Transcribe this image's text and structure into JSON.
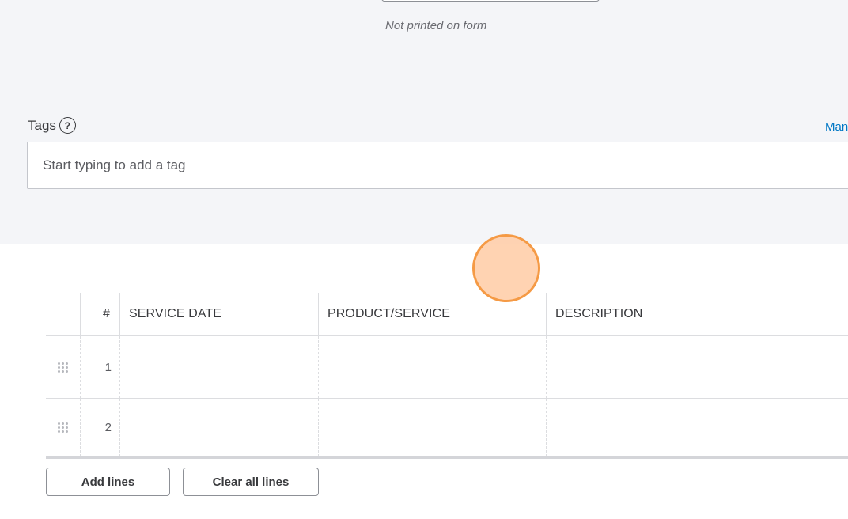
{
  "memo": {
    "note": "Not printed on form"
  },
  "tags": {
    "label": "Tags",
    "help_symbol": "?",
    "manage_link": "Manage tags",
    "placeholder": "Start typing to add a tag"
  },
  "table": {
    "headers": {
      "num": "#",
      "service_date": "SERVICE DATE",
      "product_service": "PRODUCT/SERVICE",
      "description": "DESCRIPTION"
    },
    "rows": [
      {
        "num": "1",
        "service_date": "",
        "product_service": "",
        "description": ""
      },
      {
        "num": "2",
        "service_date": "",
        "product_service": "",
        "description": ""
      }
    ]
  },
  "buttons": {
    "add_lines": "Add lines",
    "clear_all_lines": "Clear all lines"
  },
  "icons": {
    "help": "help-circle-icon",
    "drag": "drag-handle-icon"
  },
  "colors": {
    "panel_bg": "#f4f5f8",
    "link": "#0077c5",
    "text": "#393a3d",
    "cursor_fill": "#ffceaa",
    "cursor_ring": "#f59a45"
  }
}
